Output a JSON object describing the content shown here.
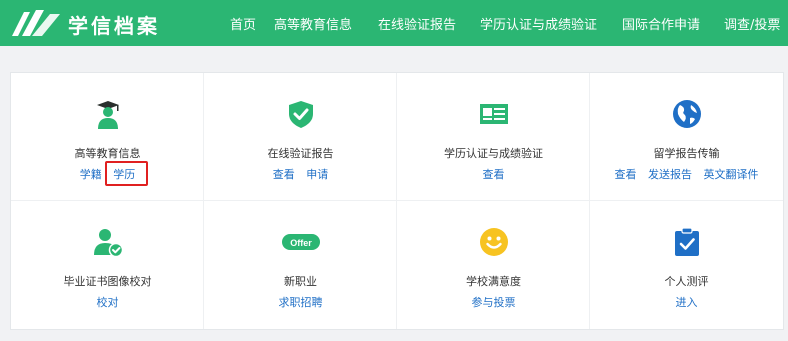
{
  "header": {
    "logo_text": "学信档案",
    "nav": [
      "首页",
      "高等教育信息",
      "在线验证报告",
      "学历认证与成绩验证",
      "国际合作申请",
      "调查/投票"
    ]
  },
  "colors": {
    "brand": "#2bb673",
    "link": "#1f6fc6",
    "highlight": "#e02020"
  },
  "cards": [
    {
      "title": "高等教育信息",
      "icon": "graduate-icon",
      "links": [
        "学籍",
        "学历"
      ]
    },
    {
      "title": "在线验证报告",
      "icon": "shield-check-icon",
      "links": [
        "查看",
        "申请"
      ]
    },
    {
      "title": "学历认证与成绩验证",
      "icon": "id-card-icon",
      "links": [
        "查看"
      ]
    },
    {
      "title": "留学报告传输",
      "icon": "globe-icon",
      "links": [
        "查看",
        "发送报告",
        "英文翻译件"
      ]
    },
    {
      "title": "毕业证书图像校对",
      "icon": "user-check-icon",
      "links": [
        "校对"
      ]
    },
    {
      "title": "新职业",
      "icon": "offer-icon",
      "links": [
        "求职招聘"
      ]
    },
    {
      "title": "学校满意度",
      "icon": "smiley-icon",
      "links": [
        "参与投票"
      ]
    },
    {
      "title": "个人测评",
      "icon": "clipboard-check-icon",
      "links": [
        "进入"
      ]
    }
  ]
}
